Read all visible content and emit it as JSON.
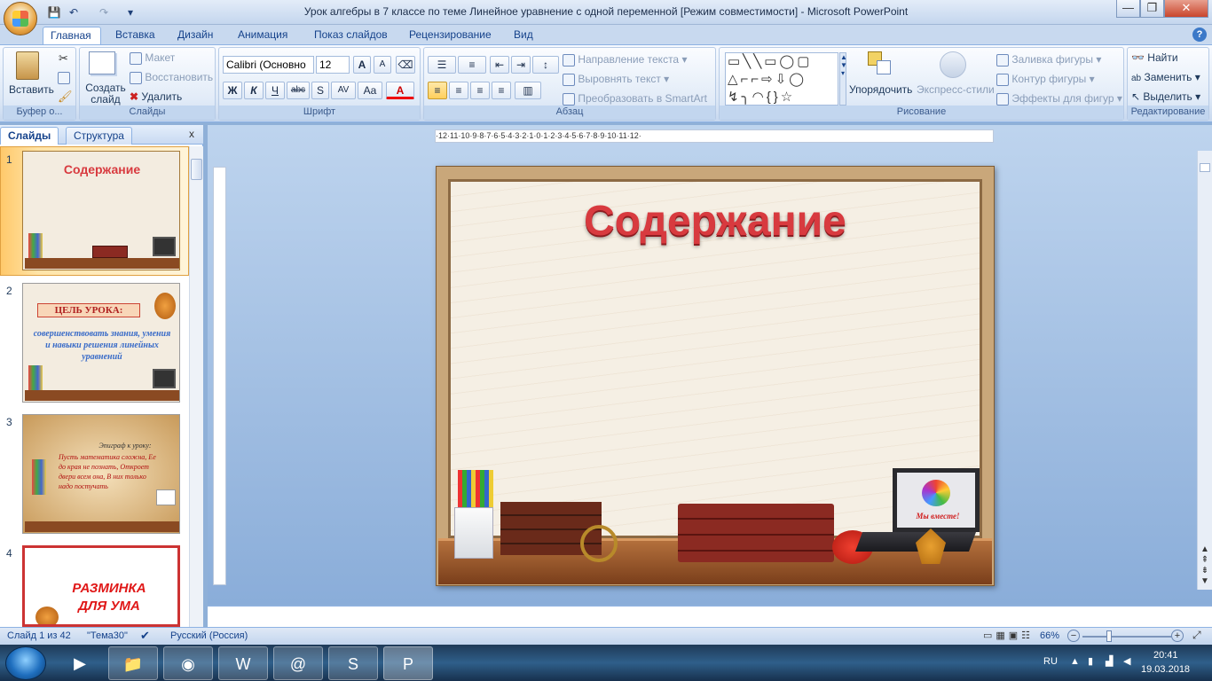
{
  "window": {
    "title": "Урок алгебры в 7 классе по теме  Линейное уравнение с одной переменной [Режим совместимости] - Microsoft PowerPoint",
    "minimize": "—",
    "maximize": "❐",
    "close": "✕"
  },
  "qat": {
    "save": "💾",
    "undo": "↶",
    "redo": "↷",
    "more": "▾"
  },
  "tabs": [
    "Главная",
    "Вставка",
    "Дизайн",
    "Анимация",
    "Показ слайдов",
    "Рецензирование",
    "Вид"
  ],
  "help": "?",
  "ribbon": {
    "clipboard": {
      "name": "Буфер о...",
      "paste": "Вставить"
    },
    "slides": {
      "name": "Слайды",
      "create": "Создать слайд",
      "layout": "Макет",
      "reset": "Восстановить",
      "delete": "Удалить"
    },
    "font": {
      "name": "Шрифт",
      "family": "Calibri (Основно",
      "size": "12",
      "grow": "A",
      "shrink": "A",
      "bold": "Ж",
      "italic": "К",
      "underline": "Ч",
      "strike": "abc",
      "shadow": "S",
      "spacing": "AV",
      "case": "Aa",
      "color": "A"
    },
    "paragraph": {
      "name": "Абзац",
      "text_direction": "Направление текста",
      "align_text": "Выровнять текст",
      "smartart": "Преобразовать в SmartArt"
    },
    "drawing": {
      "name": "Рисование",
      "arrange": "Упорядочить",
      "quick_styles": "Экспресс-стили",
      "fill": "Заливка фигуры",
      "outline": "Контур фигуры",
      "effects": "Эффекты для фигур"
    },
    "editing": {
      "name": "Редактирование",
      "find": "Найти",
      "replace": "Заменить",
      "select": "Выделить"
    }
  },
  "pane_tabs": {
    "slides": "Слайды",
    "outline": "Структура",
    "close": "x"
  },
  "thumbnails": [
    {
      "num": "1",
      "title": "Содержание"
    },
    {
      "num": "2",
      "title": "ЦЕЛЬ УРОКА:",
      "body": "совершенствовать  знания, умения и навыки решения линейных   уравнений"
    },
    {
      "num": "3",
      "title": "Эпиграф к уроку:",
      "body": "Пусть математика сложна, Ее до края не познать, Откроет двери всем она, В них только надо постучать"
    },
    {
      "num": "4",
      "title": "РАЗМИНКА ДЛЯ УМА"
    }
  ],
  "ruler": "·12·11·10·9·8·7·6·5·4·3·2·1·0·1·2·3·4·5·6·7·8·9·10·11·12·",
  "slide": {
    "title": "Содержание",
    "laptop_text": "Мы вместе!"
  },
  "status": {
    "slide": "Слайд 1 из 42",
    "theme": "\"Тема30\"",
    "language": "Русский (Россия)",
    "zoom": "66%"
  },
  "taskbar": {
    "lang": "RU",
    "time": "20:41",
    "date": "19.03.2018"
  }
}
